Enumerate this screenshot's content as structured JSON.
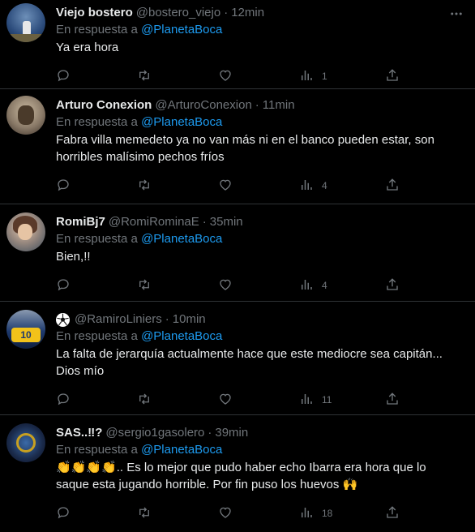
{
  "tweets": [
    {
      "name": "Viejo bostero",
      "handle": "@bostero_viejo",
      "time": "12min",
      "reply_prefix": "En respuesta a",
      "reply_to": "@PlanetaBoca",
      "text": "Ya era hora",
      "views": "1",
      "avatar_color": "#2a4a7a"
    },
    {
      "name": "Arturo Conexion",
      "handle": "@ArturoConexion",
      "time": "11min",
      "reply_prefix": "En respuesta a",
      "reply_to": "@PlanetaBoca",
      "text": "Fabra villa memedeto ya no van más ni en el banco pueden estar, son horribles malísimo pechos fríos",
      "views": "4",
      "avatar_color": "#8a7a68"
    },
    {
      "name": "RomiBj7",
      "handle": "@RomiRominaE",
      "time": "35min",
      "reply_prefix": "En respuesta a",
      "reply_to": "@PlanetaBoca",
      "text": "Bien,!!",
      "views": "4",
      "avatar_color": "#7a8a9a"
    },
    {
      "name": "",
      "handle": "@RamiroLiniers",
      "time": "10min",
      "reply_prefix": "En respuesta a",
      "reply_to": "@PlanetaBoca",
      "text": "La falta de jerarquía actualmente hace que este mediocre sea capitán... Dios mío",
      "views": "11",
      "avatar_color": "#1e3a6e"
    },
    {
      "name": "SAS..‼?",
      "handle": "@sergio1gasolero",
      "time": "39min",
      "reply_prefix": "En respuesta a",
      "reply_to": "@PlanetaBoca",
      "text_emoji": "👏👏👏👏",
      "text": ".. Es lo mejor que pudo haber echo Ibarra era hora que lo saque esta jugando horrible. Por fin puso los huevos",
      "text_end_emoji": "🙌",
      "views": "18",
      "avatar_color": "#1a2a4a"
    }
  ],
  "icons": {
    "reply": "reply-icon",
    "retweet": "retweet-icon",
    "like": "heart-icon",
    "views": "views-icon",
    "share": "share-icon",
    "more": "more-icon"
  },
  "colors": {
    "background": "#000000",
    "text": "#e7e9ea",
    "muted": "#71767b",
    "accent": "#1d9bf0",
    "divider": "#2f3336"
  }
}
